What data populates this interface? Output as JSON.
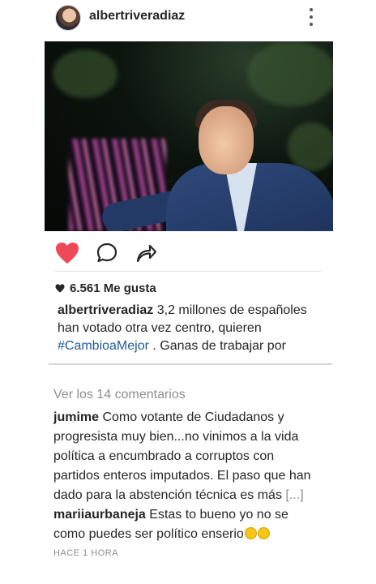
{
  "post": {
    "username": "albertriveradiaz",
    "likes_text": "6.561 Me gusta",
    "caption": {
      "user": "albertriveradiaz",
      "text_a": " 3,2 millones de españoles han votado otra vez centro, quieren ",
      "hashtag": "#CambioaMejor",
      "text_b": " . Ganas de trabajar por"
    },
    "view_comments": "Ver los 14 comentarios",
    "comments": [
      {
        "user": "jumime",
        "text": " Como votante de Ciudadanos y progresista muy bien...no vinimos a la vida política a encumbrado a corruptos con partidos enteros imputados. El paso que han dado para la abstención técnica es más ",
        "more": "[...]"
      },
      {
        "user": "mariiaurbaneja",
        "text": " Estas to bueno yo no se como puedes ser político enserio"
      }
    ],
    "timestamp": "HACE 1 HORA"
  },
  "icons": {
    "like": "heart-icon-filled",
    "comment": "comment-bubble-icon",
    "share": "share-arrow-icon",
    "more": "more-vertical-icon"
  },
  "colors": {
    "like": "#ed4956",
    "hashtag": "#1e5b99",
    "muted": "#8e8e8e"
  }
}
